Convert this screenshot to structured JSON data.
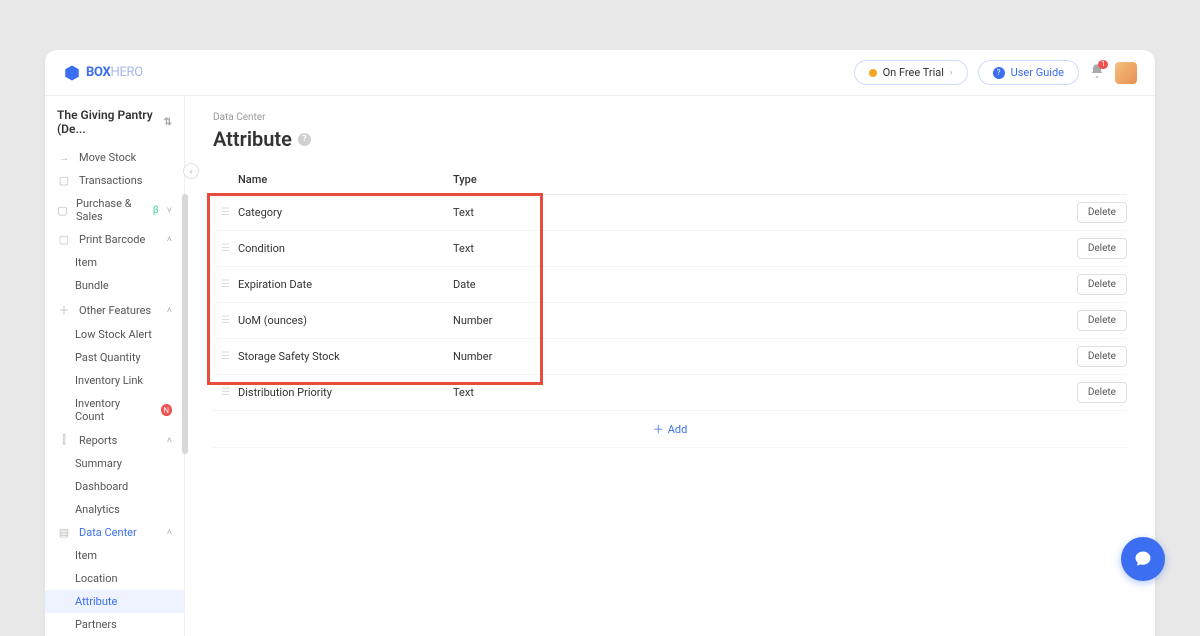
{
  "brand": {
    "name": "BOX",
    "suffix": "HERO"
  },
  "topbar": {
    "trial_label": "On Free Trial",
    "guide_label": "User Guide",
    "notif_count": "1"
  },
  "sidebar": {
    "team_name": "The Giving Pantry (De...",
    "items": [
      {
        "icon": "→",
        "label": "Move Stock",
        "type": "item"
      },
      {
        "icon": "▢",
        "label": "Transactions",
        "type": "item"
      },
      {
        "icon": "▢",
        "label": "Purchase & Sales",
        "type": "item",
        "beta": true,
        "chevron": "down"
      },
      {
        "icon": "▢",
        "label": "Print Barcode",
        "type": "item",
        "chevron": "up"
      },
      {
        "icon": "",
        "label": "Item",
        "type": "sub"
      },
      {
        "icon": "",
        "label": "Bundle",
        "type": "sub"
      },
      {
        "icon": "＋",
        "label": "Other Features",
        "type": "item",
        "chevron": "up"
      },
      {
        "icon": "",
        "label": "Low Stock Alert",
        "type": "sub"
      },
      {
        "icon": "",
        "label": "Past Quantity",
        "type": "sub"
      },
      {
        "icon": "",
        "label": "Inventory Link",
        "type": "sub"
      },
      {
        "icon": "",
        "label": "Inventory Count",
        "type": "sub",
        "new": true
      },
      {
        "icon": "⫿",
        "label": "Reports",
        "type": "item",
        "chevron": "up"
      },
      {
        "icon": "",
        "label": "Summary",
        "type": "sub"
      },
      {
        "icon": "",
        "label": "Dashboard",
        "type": "sub"
      },
      {
        "icon": "",
        "label": "Analytics",
        "type": "sub"
      },
      {
        "icon": "▤",
        "label": "Data Center",
        "type": "item",
        "chevron": "up",
        "active_head": true
      },
      {
        "icon": "",
        "label": "Item",
        "type": "sub"
      },
      {
        "icon": "",
        "label": "Location",
        "type": "sub"
      },
      {
        "icon": "",
        "label": "Attribute",
        "type": "sub",
        "active": true
      },
      {
        "icon": "",
        "label": "Partners",
        "type": "sub"
      }
    ]
  },
  "main": {
    "breadcrumb": "Data Center",
    "title": "Attribute",
    "headers": {
      "name": "Name",
      "type": "Type"
    },
    "rows": [
      {
        "name": "Category",
        "type": "Text"
      },
      {
        "name": "Condition",
        "type": "Text"
      },
      {
        "name": "Expiration Date",
        "type": "Date"
      },
      {
        "name": "UoM (ounces)",
        "type": "Number"
      },
      {
        "name": "Storage Safety Stock",
        "type": "Number"
      },
      {
        "name": "Distribution Priority",
        "type": "Text"
      }
    ],
    "delete_label": "Delete",
    "add_label": "Add"
  }
}
